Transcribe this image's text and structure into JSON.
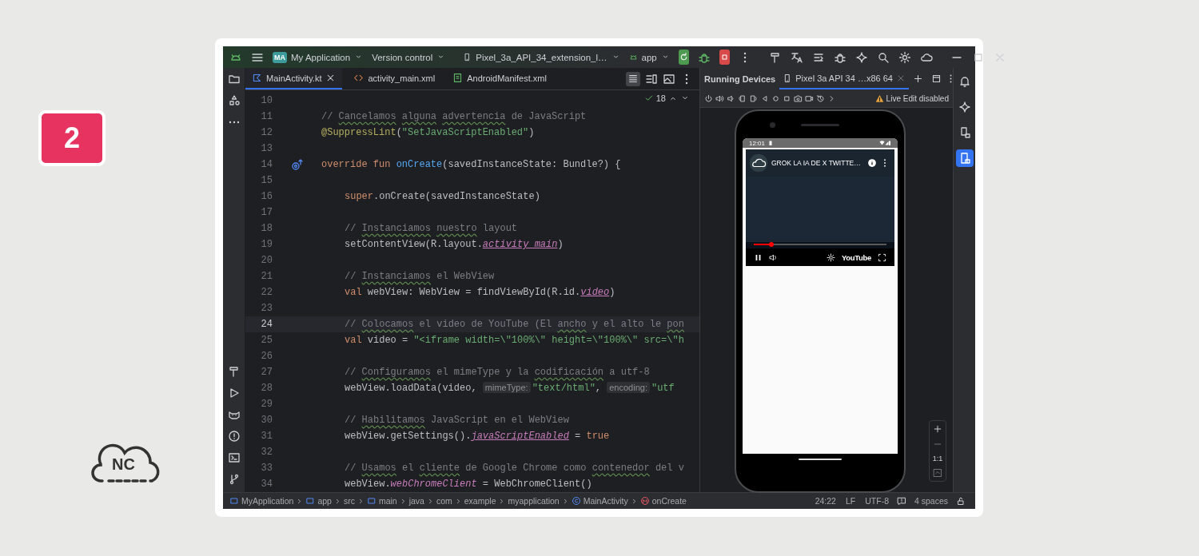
{
  "step_badge": "2",
  "logo_text": "NC",
  "titlebar": {
    "project_badge": "MA",
    "project": "My Application",
    "vcs": "Version control",
    "device": "Pixel_3a_API_34_extension_l…",
    "run_config": "app"
  },
  "editor_tabs": [
    {
      "label": "MainActivity.kt",
      "kind": "kotlin",
      "selected": true
    },
    {
      "label": "activity_main.xml",
      "kind": "xml",
      "selected": false
    },
    {
      "label": "AndroidManifest.xml",
      "kind": "manifest",
      "selected": false
    }
  ],
  "inspection_count": "18",
  "code_lines": [
    {
      "number": "10",
      "current": false,
      "marker": false
    },
    {
      "number": "11",
      "current": false,
      "marker": false,
      "tokens": [
        {
          "kind": "comment",
          "text": "// *Cancelamos* *alguna* *advertencia* de JavaScript"
        }
      ]
    },
    {
      "number": "12",
      "current": false,
      "marker": false,
      "tokens": [
        {
          "kind": "anno",
          "text": "@SuppressLint"
        },
        {
          "kind": "plain",
          "text": "("
        },
        {
          "kind": "string",
          "text": "\"SetJavaScriptEnabled\""
        },
        {
          "kind": "plain",
          "text": ")"
        }
      ]
    },
    {
      "number": "13",
      "current": false,
      "marker": false
    },
    {
      "number": "14",
      "current": false,
      "marker": true,
      "tokens": [
        {
          "kind": "kw",
          "text": "override fun "
        },
        {
          "kind": "fn",
          "text": "onCreate"
        },
        {
          "kind": "plain",
          "text": "(savedInstanceState: Bundle?) {"
        }
      ],
      "children": [
        {
          "number": "15",
          "current": false,
          "marker": false
        },
        {
          "number": "16",
          "current": false,
          "marker": false,
          "tokens": [
            {
              "kind": "kw",
              "text": "super"
            },
            {
              "kind": "plain",
              "text": ".onCreate(savedInstanceState)"
            }
          ]
        },
        {
          "number": "17",
          "current": false,
          "marker": false
        },
        {
          "number": "18",
          "current": false,
          "marker": false,
          "tokens": [
            {
              "kind": "comment",
              "text": "// *Instanciamos* *nuestro* layout"
            }
          ]
        },
        {
          "number": "19",
          "current": false,
          "marker": false,
          "tokens": [
            {
              "kind": "plain",
              "text": "setContentView(R.layout."
            },
            {
              "kind": "prop",
              "text": "activity_main"
            },
            {
              "kind": "plain",
              "text": ")"
            }
          ]
        },
        {
          "number": "20",
          "current": false,
          "marker": false
        },
        {
          "number": "21",
          "current": false,
          "marker": false,
          "tokens": [
            {
              "kind": "comment",
              "text": "// *Instanciamos* el WebView"
            }
          ]
        },
        {
          "number": "22",
          "current": false,
          "marker": false,
          "tokens": [
            {
              "kind": "kw",
              "text": "val "
            },
            {
              "kind": "plain",
              "text": "webView: WebView = findViewById(R.id."
            },
            {
              "kind": "prop",
              "text": "video"
            },
            {
              "kind": "plain",
              "text": ")"
            }
          ]
        },
        {
          "number": "23",
          "current": false,
          "marker": false
        },
        {
          "number": "24",
          "current": true,
          "marker": false,
          "tokens": [
            {
              "kind": "comment",
              "text": "// *Colocamos* el video de YouTube (El *ancho* y el alto le *pon*"
            }
          ]
        },
        {
          "number": "25",
          "current": false,
          "marker": false,
          "tokens": [
            {
              "kind": "kw",
              "text": "val "
            },
            {
              "kind": "plain",
              "text": "video = "
            },
            {
              "kind": "string",
              "text": "\"<iframe width=\\\"100%\\\" height=\\\"100%\\\" src=\\\"h"
            }
          ]
        },
        {
          "number": "26",
          "current": false,
          "marker": false
        },
        {
          "number": "27",
          "current": false,
          "marker": false,
          "tokens": [
            {
              "kind": "comment",
              "text": "// *Configuramos* el mimeType y la *codificación* a utf-8"
            }
          ]
        },
        {
          "number": "28",
          "current": false,
          "marker": false,
          "tokens": [
            {
              "kind": "plain",
              "text": "webView.loadData(video, "
            },
            {
              "kind": "hint",
              "text": "mimeType:"
            },
            {
              "kind": "string",
              "text": "\"text/html\""
            },
            {
              "kind": "plain",
              "text": ", "
            },
            {
              "kind": "hint",
              "text": "encoding:"
            },
            {
              "kind": "string",
              "text": "\"utf"
            }
          ]
        },
        {
          "number": "29",
          "current": false,
          "marker": false
        },
        {
          "number": "30",
          "current": false,
          "marker": false,
          "tokens": [
            {
              "kind": "comment",
              "text": "// *Habilitamos* JavaScript en el WebView"
            }
          ]
        },
        {
          "number": "31",
          "current": false,
          "marker": false,
          "tokens": [
            {
              "kind": "plain",
              "text": "webView.getSettings()."
            },
            {
              "kind": "prop",
              "text": "javaScriptEnabled"
            },
            {
              "kind": "plain",
              "text": " = "
            },
            {
              "kind": "kw",
              "text": "true"
            }
          ]
        },
        {
          "number": "32",
          "current": false,
          "marker": false
        },
        {
          "number": "33",
          "current": false,
          "marker": false,
          "tokens": [
            {
              "kind": "comment",
              "text": "// *Usamos* el *cliente* de Google Chrome como *contenedor* del v"
            }
          ]
        },
        {
          "number": "34",
          "current": false,
          "marker": false,
          "tokens": [
            {
              "kind": "plain",
              "text": "webView."
            },
            {
              "kind": "field",
              "text": "webChromeClient"
            },
            {
              "kind": "plain",
              "text": " = WebChromeClient()"
            }
          ]
        }
      ]
    }
  ],
  "devices_panel": {
    "title": "Running Devices",
    "device_tabs": [
      {
        "label": "Pixel 3a API 34 …x86 64",
        "selected": true
      }
    ],
    "live_edit": "Live Edit disabled"
  },
  "phone": {
    "time": "12:01",
    "video_title": "GROK LA IA DE X TWITTE…",
    "player_brand": "YouTube",
    "progress": {
      "level": 0.13
    }
  },
  "zoom_reset": "1:1",
  "right_tools": [
    {
      "kind": "notifications",
      "selected": false
    },
    {
      "kind": "gemini",
      "selected": false
    },
    {
      "kind": "device-manager",
      "selected": false
    },
    {
      "kind": "running-devices",
      "selected": true
    }
  ],
  "breadcrumbs": [
    {
      "label": "MyApplication",
      "kind": "module"
    },
    {
      "label": "app",
      "kind": "module"
    },
    {
      "label": "src",
      "kind": "dir"
    },
    {
      "label": "main",
      "kind": "module"
    },
    {
      "label": "java",
      "kind": "dir"
    },
    {
      "label": "com",
      "kind": "dir"
    },
    {
      "label": "example",
      "kind": "dir"
    },
    {
      "label": "myapplication",
      "kind": "dir"
    },
    {
      "label": "MainActivity",
      "kind": "class"
    },
    {
      "label": "onCreate",
      "kind": "method"
    }
  ],
  "status": {
    "position": "24:22",
    "line_separator": "LF",
    "encoding": "UTF-8",
    "indent": "4 spaces"
  }
}
